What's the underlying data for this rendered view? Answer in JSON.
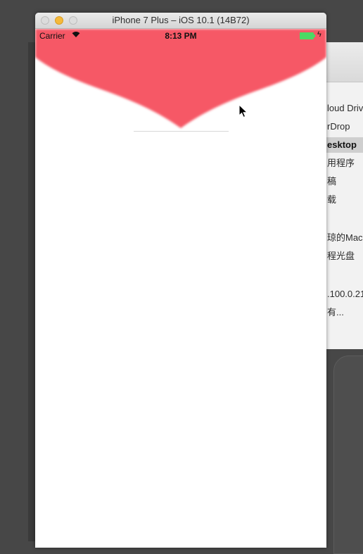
{
  "simulator": {
    "window_title": "iPhone 7 Plus – iOS 10.1 (14B72)",
    "status_bar": {
      "carrier": "Carrier",
      "time": "8:13 PM"
    },
    "header_color": "#f65866",
    "battery_color": "#4cd964"
  },
  "finder_sidebar": {
    "items": [
      {
        "label": "loud Driv"
      },
      {
        "label": "rDrop"
      },
      {
        "label": "esktop",
        "selected": true
      },
      {
        "label": "用程序"
      },
      {
        "label": "稿"
      },
      {
        "label": "载"
      },
      {
        "label": "琼的Mac"
      },
      {
        "label": "程光盘"
      },
      {
        "label": ".100.0.21"
      },
      {
        "label": "有..."
      }
    ]
  },
  "icons": {
    "wifi": "wifi-icon",
    "battery": "battery-icon",
    "charging": "bolt-icon",
    "cursor": "cursor-icon"
  }
}
